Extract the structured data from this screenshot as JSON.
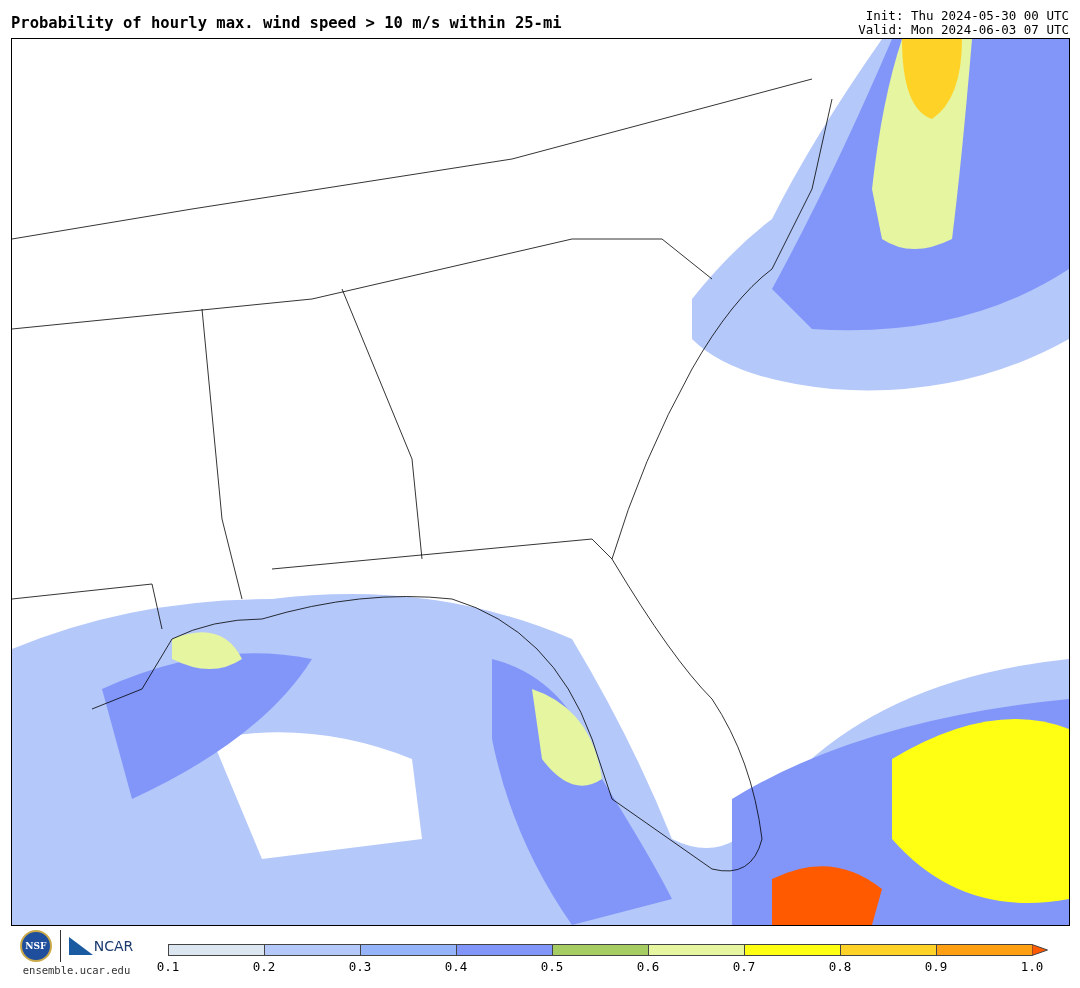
{
  "title": "Probability of hourly max. wind speed > 10 m/s within 25-mi",
  "init": "Init: Thu 2024-05-30 00 UTC",
  "valid": "Valid: Mon 2024-06-03 07 UTC",
  "logos": {
    "nsf": "NSF",
    "ncar": "NCAR",
    "url": "ensemble.ucar.edu"
  },
  "legend": {
    "segments": [
      {
        "color": "#dce6f0"
      },
      {
        "color": "#b4c8fa"
      },
      {
        "color": "#96b4fa"
      },
      {
        "color": "#8296fa"
      },
      {
        "color": "#a6cd64"
      },
      {
        "color": "#e6f5a0"
      },
      {
        "color": "#ffff14"
      },
      {
        "color": "#ffd228"
      },
      {
        "color": "#ffa014"
      }
    ],
    "arrow": {
      "color": "#ff5a00"
    },
    "ticks": [
      "0.1",
      "0.2",
      "0.3",
      "0.4",
      "0.5",
      "0.6",
      "0.7",
      "0.8",
      "0.9",
      "1.0"
    ]
  }
}
